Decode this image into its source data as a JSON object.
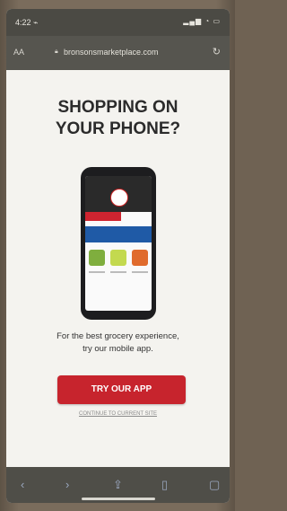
{
  "status_bar": {
    "time": "4:22 ⌁",
    "indicators": "▂▄▆ ◔ ▭"
  },
  "browser": {
    "aa_label": "AA",
    "url": "bronsonsmarketplace.com",
    "lock_icon": "lock-icon",
    "reload_icon": "reload-icon"
  },
  "page": {
    "headline_line1": "SHOPPING ON",
    "headline_line2": "YOUR PHONE?",
    "lead_line1": "For the best grocery experience,",
    "lead_line2": "try our mobile app.",
    "cta_label": "TRY OUR APP",
    "continue_label": "CONTINUE TO CURRENT SITE"
  },
  "bottom_toolbar": {
    "icons": [
      "back-icon",
      "forward-icon",
      "share-icon",
      "bookmarks-icon",
      "tabs-icon"
    ],
    "glyphs": [
      "‹",
      "›",
      "⇪",
      "▯",
      "▢"
    ]
  },
  "colors": {
    "accent": "#c7242d",
    "text": "#2b2b2b"
  }
}
